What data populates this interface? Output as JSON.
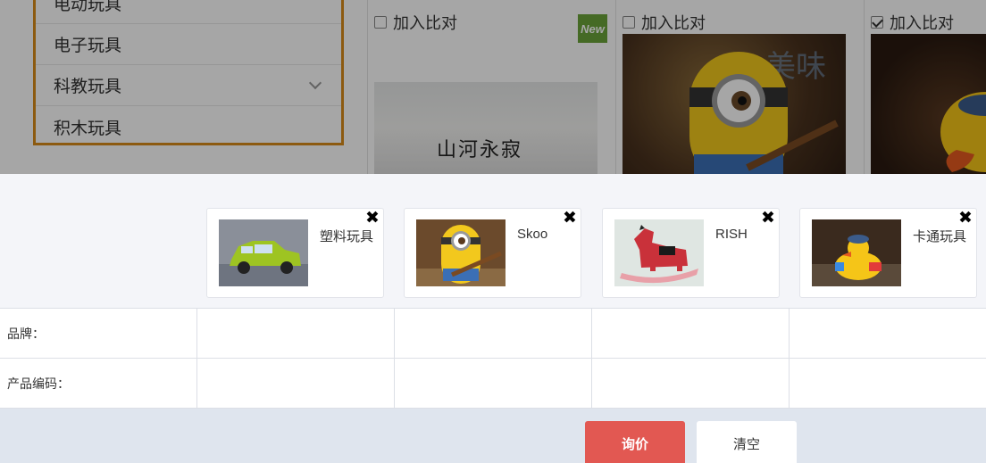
{
  "background": {
    "categories": [
      {
        "label": "电动玩具",
        "chevron": false
      },
      {
        "label": "电子玩具",
        "chevron": false
      },
      {
        "label": "科教玩具",
        "chevron": true
      },
      {
        "label": "积木玩具",
        "chevron": false
      }
    ],
    "compare_label": "加入比对",
    "new_badge": "New",
    "ink_art_text": "山河永寂",
    "minion_watermark": "美味"
  },
  "compare": {
    "items": [
      {
        "name": "塑料玩具",
        "image": "green-toy-car"
      },
      {
        "name": "Skoo",
        "image": "minion-guitar"
      },
      {
        "name": "RISH",
        "image": "rocking-horse"
      },
      {
        "name": "卡通玩具",
        "image": "rubber-duck"
      }
    ],
    "close_icon": "✖",
    "rows": [
      {
        "label": "品牌："
      },
      {
        "label": "产品编码："
      }
    ],
    "inquiry_button": "询价",
    "clear_button": "清空"
  },
  "colors": {
    "accent_orange": "#d88a1a",
    "inquiry_red": "#e25852",
    "new_green": "#6aa33a",
    "footer_bg": "#dfe5ee"
  }
}
